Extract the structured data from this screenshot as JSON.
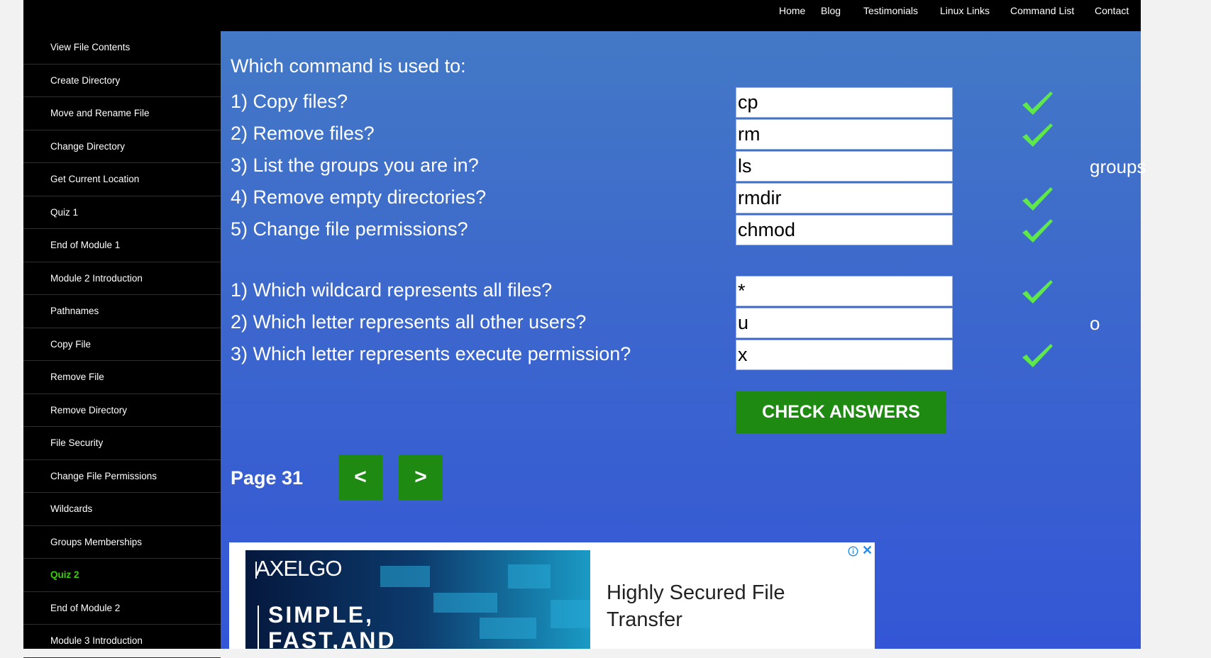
{
  "topnav": {
    "items": [
      "Home",
      "Blog",
      "Testimonials",
      "Linux Links",
      "Command List",
      "Contact"
    ]
  },
  "sidebar": {
    "items": [
      {
        "label": "View File Contents",
        "active": false
      },
      {
        "label": "Create Directory",
        "active": false
      },
      {
        "label": "Move and Rename File",
        "active": false
      },
      {
        "label": "Change Directory",
        "active": false
      },
      {
        "label": "Get Current Location",
        "active": false
      },
      {
        "label": "Quiz 1",
        "active": false
      },
      {
        "label": "End of Module 1",
        "active": false
      },
      {
        "label": "Module 2 Introduction",
        "active": false
      },
      {
        "label": "Pathnames",
        "active": false
      },
      {
        "label": "Copy File",
        "active": false
      },
      {
        "label": "Remove File",
        "active": false
      },
      {
        "label": "Remove Directory",
        "active": false
      },
      {
        "label": "File Security",
        "active": false
      },
      {
        "label": "Change File Permissions",
        "active": false
      },
      {
        "label": "Wildcards",
        "active": false
      },
      {
        "label": "Groups Memberships",
        "active": false
      },
      {
        "label": "Quiz 2",
        "active": true
      },
      {
        "label": "End of Module 2",
        "active": false
      },
      {
        "label": "Module 3 Introduction",
        "active": false
      }
    ],
    "active_color": "#39d000"
  },
  "quiz": {
    "heading": "Which command is used to:",
    "questions": [
      {
        "text": "1) Copy files?",
        "answer": "cp",
        "correct": true,
        "correction": ""
      },
      {
        "text": "2) Remove files?",
        "answer": "rm",
        "correct": true,
        "correction": ""
      },
      {
        "text": "3) List the groups you are in?",
        "answer": "ls",
        "correct": false,
        "correction": "groups"
      },
      {
        "text": "4) Remove empty directories?",
        "answer": "rmdir",
        "correct": true,
        "correction": ""
      },
      {
        "text": "5) Change file permissions?",
        "answer": "chmod",
        "correct": true,
        "correction": ""
      },
      {
        "text": "1) Which wildcard represents all files?",
        "answer": "*",
        "correct": true,
        "correction": ""
      },
      {
        "text": "2) Which letter represents all other users?",
        "answer": "u",
        "correct": false,
        "correction": "o"
      },
      {
        "text": "3) Which letter represents execute permission?",
        "answer": "x",
        "correct": true,
        "correction": ""
      }
    ],
    "check_button": "CHECK ANSWERS",
    "check_color": "#5ee84a"
  },
  "pagination": {
    "page_label": "Page 31",
    "prev": "<",
    "next": ">"
  },
  "ad": {
    "brand": "AXELGO",
    "slogan_line1": "SIMPLE,",
    "slogan_line2": "FAST,AND",
    "headline": "Highly Secured File Transfer",
    "info_icon": "info-icon",
    "close": "✕"
  },
  "colors": {
    "button_green": "#1e8a12",
    "main_top": "#4379c6",
    "main_bottom": "#3456d6"
  }
}
